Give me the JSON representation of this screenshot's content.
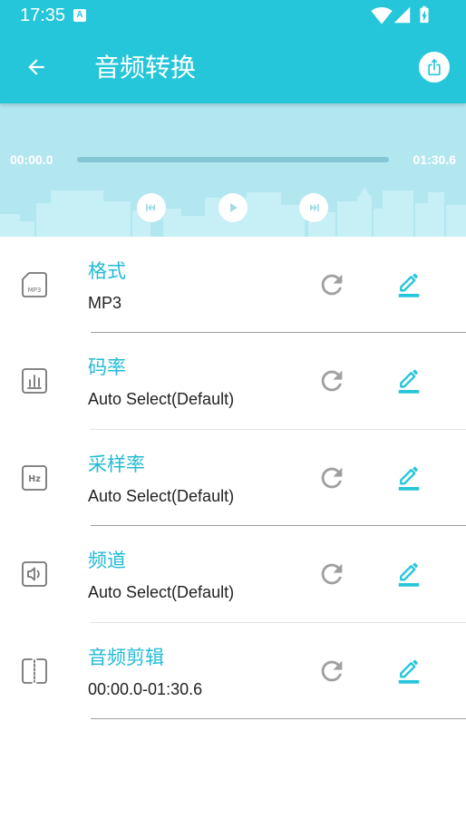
{
  "status_bar": {
    "time": "17:35",
    "notification_badge": "A",
    "icons": {
      "notification": "a-letter-icon",
      "wifi": "wifi-icon",
      "signal": "cell-signal-icon",
      "battery": "battery-charging-icon"
    }
  },
  "app_bar": {
    "title": "音频转换",
    "back_icon": "arrow-left-icon",
    "share_icon": "share-upload-icon"
  },
  "player": {
    "current_time": "00:00.0",
    "total_time": "01:30.6",
    "progress": 0,
    "controls": {
      "previous": "skip-previous-icon",
      "play": "play-icon",
      "next": "skip-next-icon"
    }
  },
  "settings": {
    "items": [
      {
        "title": "格式",
        "value": "MP3",
        "icon": "mp3-file-icon",
        "icon_label": "MP3",
        "reset_icon": "refresh-icon",
        "edit_icon": "edit-pencil-icon"
      },
      {
        "title": "码率",
        "value": "Auto Select(Default)",
        "icon": "bitrate-bars-icon",
        "reset_icon": "refresh-icon",
        "edit_icon": "edit-pencil-icon"
      },
      {
        "title": "采样率",
        "value": "Auto Select(Default)",
        "icon": "sample-rate-hz-icon",
        "icon_label": "Hz",
        "reset_icon": "refresh-icon",
        "edit_icon": "edit-pencil-icon"
      },
      {
        "title": "频道",
        "value": "Auto Select(Default)",
        "icon": "channel-speaker-icon",
        "reset_icon": "refresh-icon",
        "edit_icon": "edit-pencil-icon"
      },
      {
        "title": "音频剪辑",
        "value": "00:00.0-01:30.6",
        "icon": "audio-clip-split-icon",
        "reset_icon": "refresh-icon",
        "edit_icon": "edit-pencil-icon"
      }
    ]
  },
  "colors": {
    "primary": "#26C6DA",
    "title_text": "#23BBD5",
    "player_bg": "#B2E7F0",
    "skyline": "#C6EFF6",
    "track": "#84C6D3",
    "icon_gray": "#757575",
    "refresh_gray": "#A0A0A0",
    "control_icon": "#A3DCE6",
    "text_dark": "#222222"
  }
}
